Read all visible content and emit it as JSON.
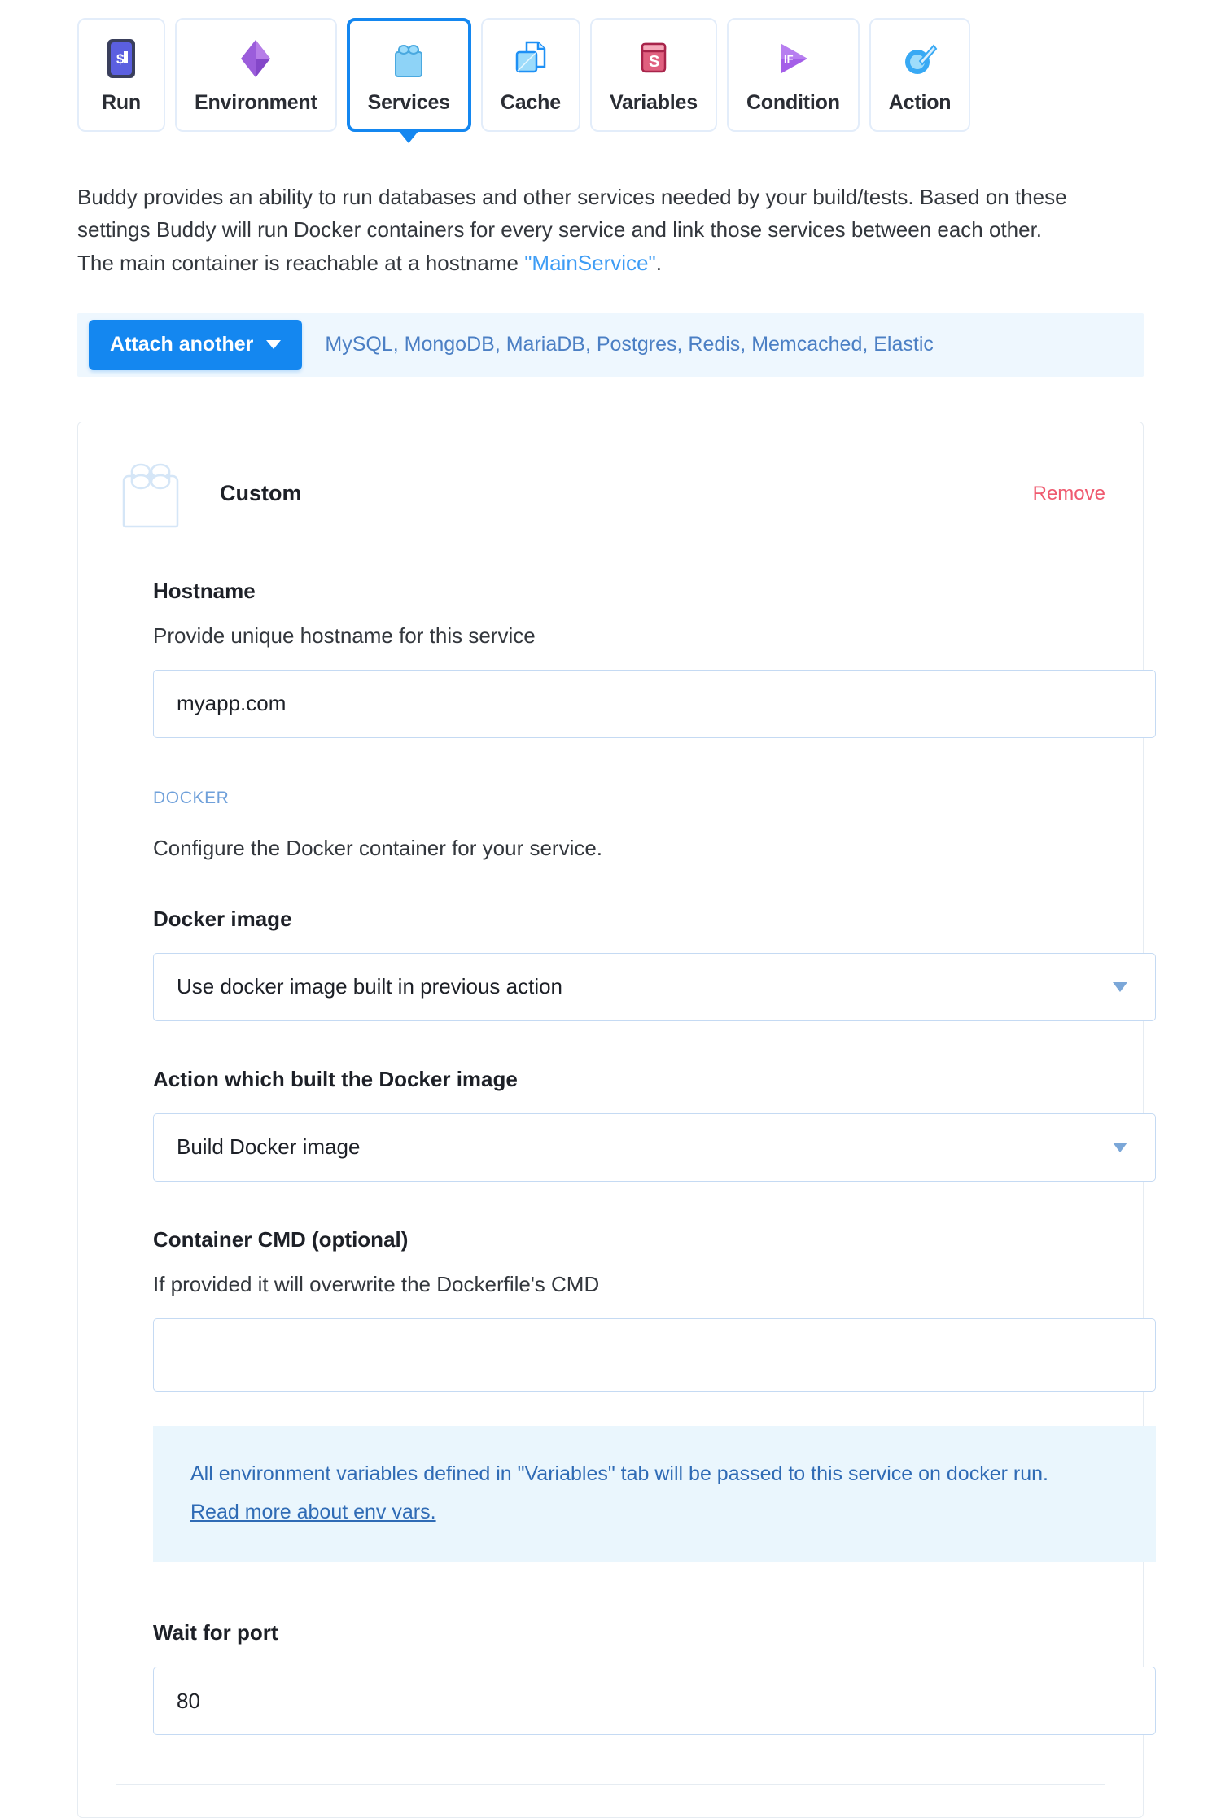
{
  "tabs": [
    {
      "label": "Run",
      "icon": "run-icon",
      "active": false
    },
    {
      "label": "Environment",
      "icon": "environment-icon",
      "active": false
    },
    {
      "label": "Services",
      "icon": "services-icon",
      "active": true
    },
    {
      "label": "Cache",
      "icon": "cache-icon",
      "active": false
    },
    {
      "label": "Variables",
      "icon": "variables-icon",
      "active": false
    },
    {
      "label": "Condition",
      "icon": "condition-icon",
      "active": false
    },
    {
      "label": "Action",
      "icon": "action-icon",
      "active": false
    }
  ],
  "intro": {
    "part1": "Buddy provides an ability to run databases and other services needed by your build/tests. Based on these settings Buddy will run Docker containers for every service and link those services between each other. The main container is reachable at a hostname ",
    "link": "\"MainService\"",
    "part2": "."
  },
  "attach": {
    "button_label": "Attach another",
    "services_list": "MySQL, MongoDB, MariaDB, Postgres, Redis, Memcached, Elastic"
  },
  "service_card": {
    "title": "Custom",
    "icon": "custom-service-icon",
    "remove_label": "Remove",
    "hostname": {
      "label": "Hostname",
      "help": "Provide unique hostname for this service",
      "value": "myapp.com",
      "placeholder": ""
    },
    "docker_section": {
      "divider_label": "DOCKER",
      "description": "Configure the Docker container for your service.",
      "image": {
        "label": "Docker image",
        "selected": "Use docker image built in previous action"
      },
      "action": {
        "label": "Action which built the Docker image",
        "selected": "Build Docker image"
      },
      "cmd": {
        "label": "Container CMD (optional)",
        "help": "If provided it will overwrite the Dockerfile's CMD",
        "value": "",
        "placeholder": ""
      },
      "notice": {
        "text": "All environment variables defined in \"Variables\" tab will be passed to this service on docker run.",
        "link": "Read more about env vars."
      }
    },
    "wait_for_port": {
      "label": "Wait for port",
      "value": "80",
      "placeholder": ""
    }
  },
  "colors": {
    "accent": "#1487f0",
    "link": "#3d9cf5",
    "danger": "#ef5a6f",
    "notice_bg": "#eaf6fd",
    "notice_text": "#2f6bb5",
    "attach_bg": "#eef7fe"
  }
}
